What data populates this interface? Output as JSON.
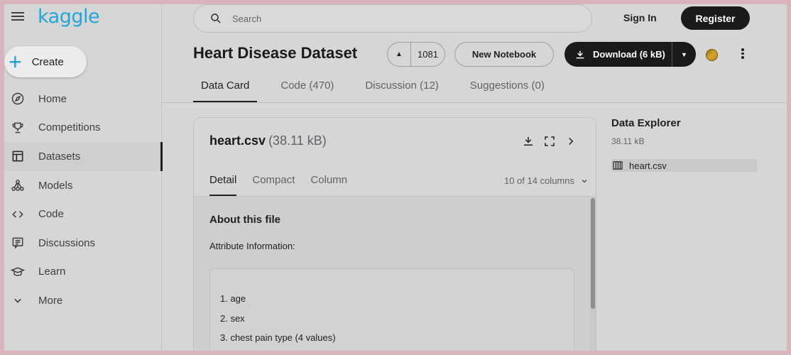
{
  "brand": {
    "logo_text": "kaggle",
    "accent": "#20a7d8"
  },
  "sidebar": {
    "create_label": "Create",
    "items": [
      {
        "label": "Home",
        "icon": "compass-icon"
      },
      {
        "label": "Competitions",
        "icon": "trophy-icon"
      },
      {
        "label": "Datasets",
        "icon": "table-icon",
        "active": true
      },
      {
        "label": "Models",
        "icon": "models-icon"
      },
      {
        "label": "Code",
        "icon": "code-icon"
      },
      {
        "label": "Discussions",
        "icon": "comments-icon"
      },
      {
        "label": "Learn",
        "icon": "graduation-cap-icon"
      },
      {
        "label": "More",
        "icon": "chevron-down-icon"
      }
    ]
  },
  "header": {
    "search_placeholder": "Search",
    "signin_label": "Sign In",
    "register_label": "Register"
  },
  "dataset": {
    "title": "Heart Disease Dataset",
    "vote_count": "1081",
    "new_notebook_label": "New Notebook",
    "download_label": "Download (6 kB)"
  },
  "tabs": [
    {
      "label": "Data Card",
      "active": true
    },
    {
      "label": "Code (470)"
    },
    {
      "label": "Discussion (12)"
    },
    {
      "label": "Suggestions (0)"
    }
  ],
  "file": {
    "name": "heart.csv",
    "size": "(38.11 kB)",
    "subtabs": [
      {
        "label": "Detail",
        "active": true
      },
      {
        "label": "Compact"
      },
      {
        "label": "Column"
      }
    ],
    "column_selector": "10 of 14 columns",
    "about_heading": "About this file",
    "attribute_heading": "Attribute Information:",
    "attributes": [
      "1. age",
      "2. sex",
      "3. chest pain type (4 values)"
    ]
  },
  "explorer": {
    "title": "Data Explorer",
    "size": "38.11 kB",
    "files": [
      "heart.csv"
    ]
  }
}
